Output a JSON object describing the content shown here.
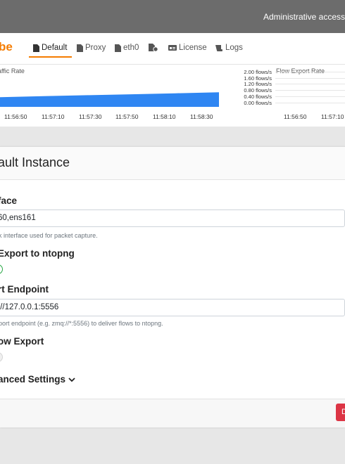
{
  "topbar": {
    "admin_text": "Administrative access"
  },
  "brand": {
    "text": "be",
    "color": "#f57c00"
  },
  "nav": {
    "items": [
      {
        "label": "Default",
        "icon": "file-icon",
        "active": true
      },
      {
        "label": "Proxy",
        "icon": "file-icon"
      },
      {
        "label": "eth0",
        "icon": "file-icon"
      },
      {
        "label": "",
        "icon": "file-gear-icon"
      },
      {
        "label": "License",
        "icon": "id-card-icon"
      },
      {
        "label": "Logs",
        "icon": "scroll-icon"
      }
    ]
  },
  "charts": {
    "traffic": {
      "title": "affic Rate"
    },
    "flow": {
      "title": "Flow Export Rate",
      "y_ticks": [
        "2.00 flows/s",
        "1.60 flows/s",
        "1.20 flows/s",
        "0.80 flows/s",
        "0.40 flows/s",
        "0.00 flows/s"
      ]
    }
  },
  "chart_data": [
    {
      "type": "area",
      "title": "affic Rate",
      "x": [
        "11:56:50",
        "11:57:10",
        "11:57:30",
        "11:57:50",
        "11:58:10",
        "11:58:30"
      ],
      "series": [
        {
          "values": [
            40,
            44,
            48,
            52,
            56,
            60
          ]
        }
      ],
      "color": "#2f86f2"
    },
    {
      "type": "line",
      "title": "Flow Export Rate",
      "x": [
        "11:56:50",
        "11:57:10"
      ],
      "y_ticks": [
        "2.00 flows/s",
        "1.60 flows/s",
        "1.20 flows/s",
        "0.80 flows/s",
        "0.40 flows/s",
        "0.00 flows/s"
      ],
      "ylim": [
        0,
        2
      ]
    }
  ],
  "card": {
    "title": "ault Instance",
    "interface": {
      "label": "face",
      "value": "60,ens161",
      "help": "k interface used for packet capture."
    },
    "export_ntopng": {
      "label": "Export to ntopng",
      "enabled": true
    },
    "endpoint": {
      "label": "rt Endpoint",
      "value": "://127.0.0.1:5556",
      "help": "port endpoint (e.g. zmq://*:5556) to deliver flows to ntopng."
    },
    "flow_export": {
      "label": "ow Export",
      "enabled": false
    },
    "advanced": {
      "label": "anced Settings"
    },
    "delete_label": "D"
  }
}
